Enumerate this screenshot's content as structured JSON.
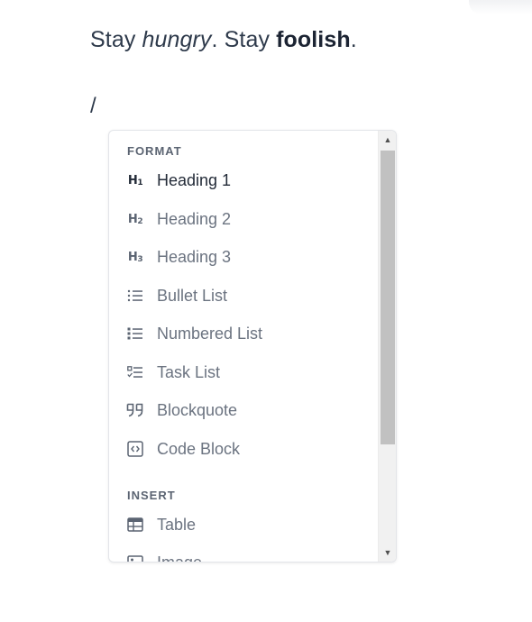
{
  "editor": {
    "text_part1": "Stay ",
    "text_italic": "hungry",
    "text_part2": ". Stay ",
    "text_bold": "foolish",
    "text_part3": ".",
    "slash": "/"
  },
  "menu": {
    "sections": [
      {
        "label": "FORMAT"
      },
      {
        "label": "INSERT"
      }
    ],
    "items": [
      {
        "label": "Heading 1",
        "icon": "heading-1-icon",
        "icon_text": "H",
        "icon_sub": "1"
      },
      {
        "label": "Heading 2",
        "icon": "heading-2-icon",
        "icon_text": "H",
        "icon_sub": "2"
      },
      {
        "label": "Heading 3",
        "icon": "heading-3-icon",
        "icon_text": "H",
        "icon_sub": "3"
      },
      {
        "label": "Bullet List",
        "icon": "bullet-list-icon"
      },
      {
        "label": "Numbered List",
        "icon": "numbered-list-icon"
      },
      {
        "label": "Task List",
        "icon": "task-list-icon"
      },
      {
        "label": "Blockquote",
        "icon": "blockquote-icon"
      },
      {
        "label": "Code Block",
        "icon": "code-block-icon"
      },
      {
        "label": "Table",
        "icon": "table-icon"
      },
      {
        "label": "Image",
        "icon": "image-icon"
      }
    ],
    "scrollbar": {
      "up_arrow": "▲",
      "down_arrow": "▼"
    }
  }
}
